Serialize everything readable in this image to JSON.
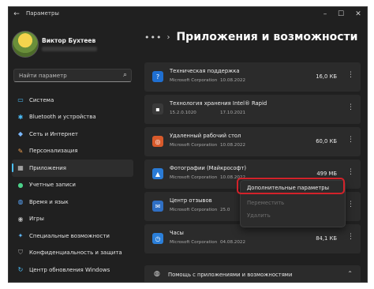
{
  "window": {
    "title": "Параметры",
    "back_glyph": "←",
    "controls": [
      "–",
      "☐",
      "✕"
    ]
  },
  "user": {
    "name": "Виктор Бухтеев"
  },
  "search": {
    "placeholder": "Найти параметр",
    "icon": "search-icon"
  },
  "nav": [
    {
      "label": "Система",
      "icon": "monitor-icon",
      "color": "#4cc2ff",
      "glyph": "▭"
    },
    {
      "label": "Bluetooth и устройства",
      "icon": "bluetooth-icon",
      "color": "#4cc2ff",
      "glyph": "✱"
    },
    {
      "label": "Сеть и Интернет",
      "icon": "wifi-icon",
      "color": "#7ab8ff",
      "glyph": "◆"
    },
    {
      "label": "Персонализация",
      "icon": "brush-icon",
      "color": "#f0a050",
      "glyph": "✎"
    },
    {
      "label": "Приложения",
      "icon": "apps-icon",
      "color": "#c8c8c8",
      "glyph": "▦"
    },
    {
      "label": "Учетные записи",
      "icon": "person-icon",
      "color": "#4cd28a",
      "glyph": "●"
    },
    {
      "label": "Время и язык",
      "icon": "globe-icon",
      "color": "#5aa8ff",
      "glyph": "◍"
    },
    {
      "label": "Игры",
      "icon": "gamepad-icon",
      "color": "#b9b9b9",
      "glyph": "◉"
    },
    {
      "label": "Специальные возможности",
      "icon": "accessibility-icon",
      "color": "#5fb8ff",
      "glyph": "✦"
    },
    {
      "label": "Конфиденциальность и защита",
      "icon": "shield-icon",
      "color": "#a0a0a0",
      "glyph": "⛉"
    },
    {
      "label": "Центр обновления Windows",
      "icon": "update-icon",
      "color": "#4cc2ff",
      "glyph": "↻"
    }
  ],
  "nav_active": "Приложения",
  "header": {
    "dots": "•••",
    "chevron": "›",
    "title": "Приложения и возможности"
  },
  "apps": [
    {
      "name": "Техническая поддержка",
      "publisher": "Microsoft Corporation",
      "date": "10.08.2022",
      "size": "16,0 КБ",
      "icon": "help-app-icon",
      "color": "#1f6fd1",
      "glyph": "?"
    },
    {
      "name": "Технология хранения Intel® Rapid",
      "publisher": "15.2.0.1020",
      "date": "17.10.2021",
      "size": "",
      "icon": "intel-storage-icon",
      "color": "#3a3a3a",
      "glyph": "▪"
    },
    {
      "name": "Удаленный рабочий стол",
      "publisher": "Microsoft Corporation",
      "date": "10.08.2022",
      "size": "60,0 КБ",
      "icon": "remote-desktop-icon",
      "color": "#d85a2b",
      "glyph": "◎"
    },
    {
      "name": "Фотографии (Майкрософт)",
      "publisher": "Microsoft Corporation",
      "date": "10.08.2022",
      "size": "499 МБ",
      "icon": "photos-icon",
      "color": "#2a7bd6",
      "glyph": "▲"
    },
    {
      "name": "Центр отзывов",
      "publisher": "Microsoft Corporation",
      "date": "25.0",
      "size": "",
      "icon": "feedback-hub-icon",
      "color": "#2f6fc4",
      "glyph": "✉"
    },
    {
      "name": "Часы",
      "publisher": "Microsoft Corporation",
      "date": "04.08.2022",
      "size": "84,1 КБ",
      "icon": "clock-icon",
      "color": "#2b7fd9",
      "glyph": "◷"
    }
  ],
  "more_glyph": "⋮",
  "context_menu": [
    {
      "label": "Дополнительные параметры",
      "enabled": true
    },
    {
      "label": "Переместить",
      "enabled": false
    },
    {
      "label": "Удалить",
      "enabled": false
    }
  ],
  "help": {
    "label": "Помощь с приложениями и возможностями",
    "icon": "globe-icon",
    "chevron": "⌃"
  },
  "highlight_color": "#d3222a"
}
